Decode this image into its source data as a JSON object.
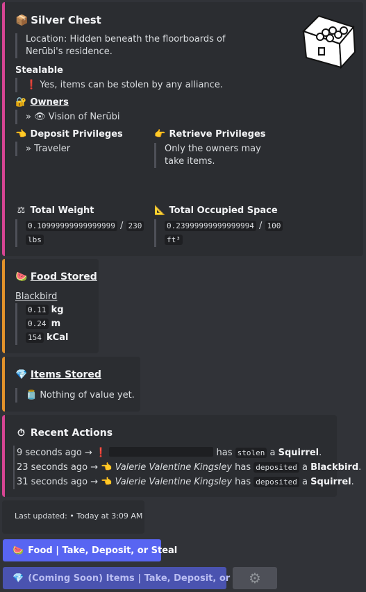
{
  "chest": {
    "title": "Silver Chest",
    "title_icon": "package-icon",
    "location": "Location: Hidden beneath the floorboards of Nerūbi's residence.",
    "stealable_label": "Stealable",
    "stealable_value": "Yes, items can be stolen by any alliance.",
    "owners_label": "Owners",
    "owners_value": "» 👁 Vision of Nerūbi",
    "deposit_label": "Deposit Privileges",
    "deposit_value": "» Traveler",
    "retrieve_label": "Retrieve Privileges",
    "retrieve_value": "Only the owners may take items.",
    "weight_label": "Total Weight",
    "weight_value": "0.10999999999999999",
    "weight_max": "230",
    "weight_unit": "lbs",
    "weight_sep": "/",
    "space_label": "Total Occupied Space",
    "space_value": "0.23999999999999994",
    "space_max": "100",
    "space_unit": "ft³",
    "space_sep": "/"
  },
  "food": {
    "title": "Food Stored",
    "item_name": "Blackbird",
    "rows": [
      {
        "value": "0.11",
        "unit": "kg"
      },
      {
        "value": "0.24",
        "unit": "m"
      },
      {
        "value": "154",
        "unit": "kCal"
      }
    ]
  },
  "items": {
    "title": "Items Stored",
    "empty": "Nothing of value yet."
  },
  "actions": {
    "title": "Recent Actions",
    "rows": [
      {
        "time": "9 seconds ago",
        "arrow": "→",
        "actor": "",
        "has": "has",
        "verb": "stolen",
        "a": "a",
        "object": "Squirrel",
        "end": "."
      },
      {
        "time": "23 seconds ago",
        "arrow": "→",
        "actor": "Valerie Valentine Kingsley",
        "has": "has",
        "verb": "deposited",
        "a": "a",
        "object": "Blackbird",
        "end": "."
      },
      {
        "time": "31 seconds ago",
        "arrow": "→",
        "actor": "Valerie Valentine Kingsley",
        "has": "has",
        "verb": "deposited",
        "a": "a",
        "object": "Squirrel",
        "end": "."
      }
    ]
  },
  "footer": {
    "last_updated": "Last updated: • Today at 3:09 AM"
  },
  "buttons": {
    "food": "Food | Take, Deposit, or Steal",
    "items": "(Coming Soon) Items | Take, Deposit, or Steal",
    "settings_icon": "gear-icon"
  },
  "colors": {
    "accent_pink": "#d64593",
    "accent_orange": "#e3922b",
    "button_blurple": "#5865f2"
  }
}
